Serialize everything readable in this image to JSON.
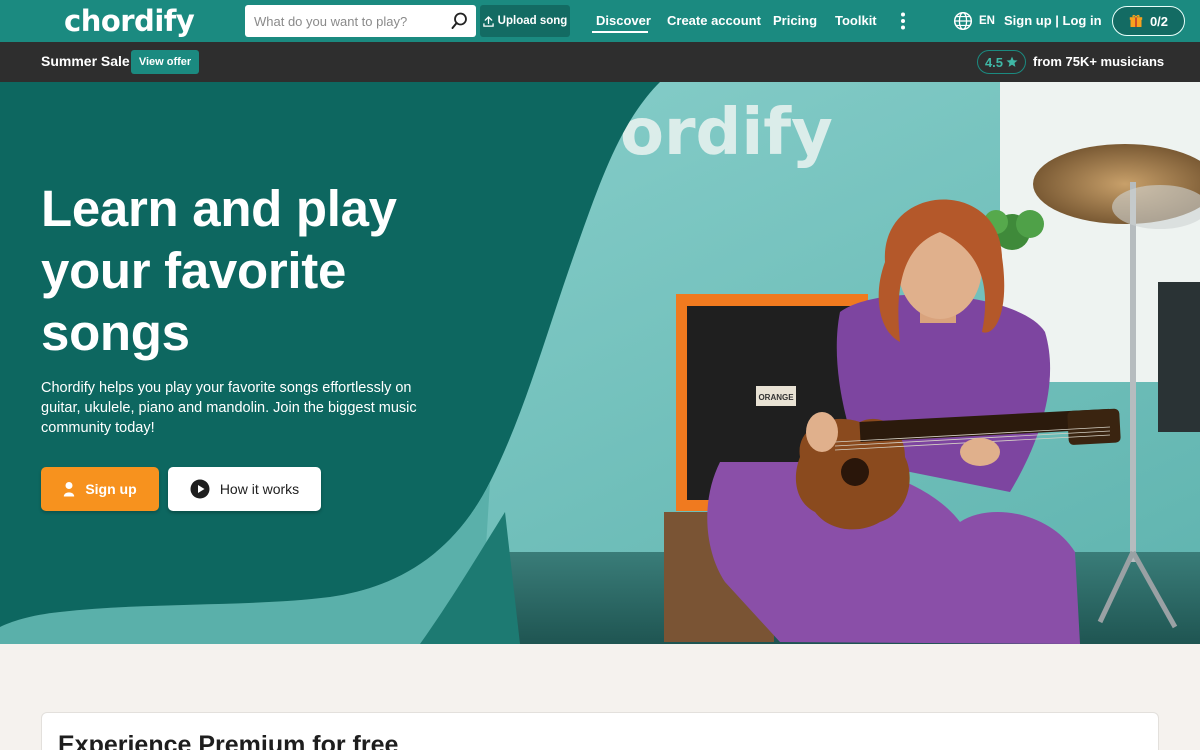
{
  "header": {
    "logo": "chordify",
    "search_placeholder": "What do you want to play?",
    "upload_label": "Upload song",
    "nav": [
      "Discover",
      "Create account",
      "Pricing",
      "Toolkit"
    ],
    "language": "EN",
    "auth_label": "Sign up | Log in",
    "gift_count": "0/2"
  },
  "promo": {
    "sale_text": "Summer Sale!",
    "offer_label": "View offer",
    "rating": "4.5",
    "rating_text": "from 75K+ musicians"
  },
  "hero": {
    "title": "Learn and play your favorite songs",
    "subtitle": "Chordify helps you play your favorite songs effortlessly on guitar, ukulele, piano and mandolin. Join the biggest music community today!",
    "signup_label": "Sign up",
    "how_label": "How it works",
    "photo_wall_text": "ordify",
    "amp_label": "ORANGE"
  },
  "premium": {
    "title": "Experience Premium for free"
  },
  "colors": {
    "brand_teal": "#1b8a80",
    "dark_teal": "#0d6760",
    "accent_orange": "#f7921e",
    "promo_bg": "#2e2e2e"
  },
  "icons": [
    "search-icon",
    "upload-icon",
    "more-vertical-icon",
    "globe-icon",
    "gift-icon",
    "star-icon",
    "user-icon",
    "play-icon"
  ]
}
